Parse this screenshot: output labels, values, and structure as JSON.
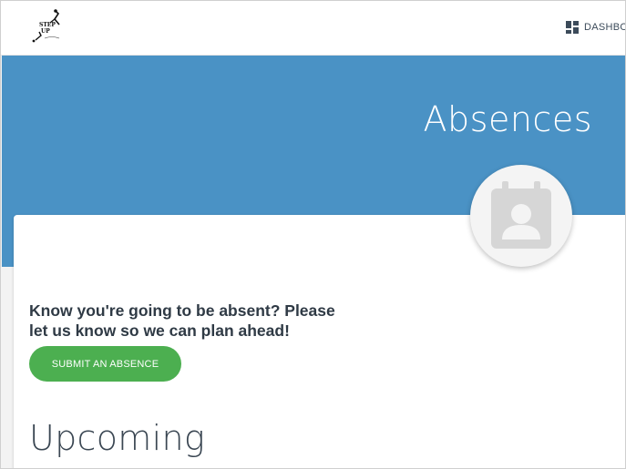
{
  "nav": {
    "dashboard_label": "DASHBO",
    "logo_text": "STEP UP"
  },
  "hero": {
    "title": "Absences"
  },
  "card": {
    "prompt": "Know you're going to be absent? Please let us know so we can plan ahead!",
    "submit_label": "SUBMIT AN ABSENCE",
    "section_title": "Upcoming"
  },
  "icons": {
    "dashboard": "dashboard-grid-icon",
    "avatar": "contact-card-icon",
    "logo": "dancer-logo"
  },
  "colors": {
    "hero_blue": "#4a92c5",
    "submit_green": "#4caf50",
    "text_dark": "#2f3a45"
  }
}
